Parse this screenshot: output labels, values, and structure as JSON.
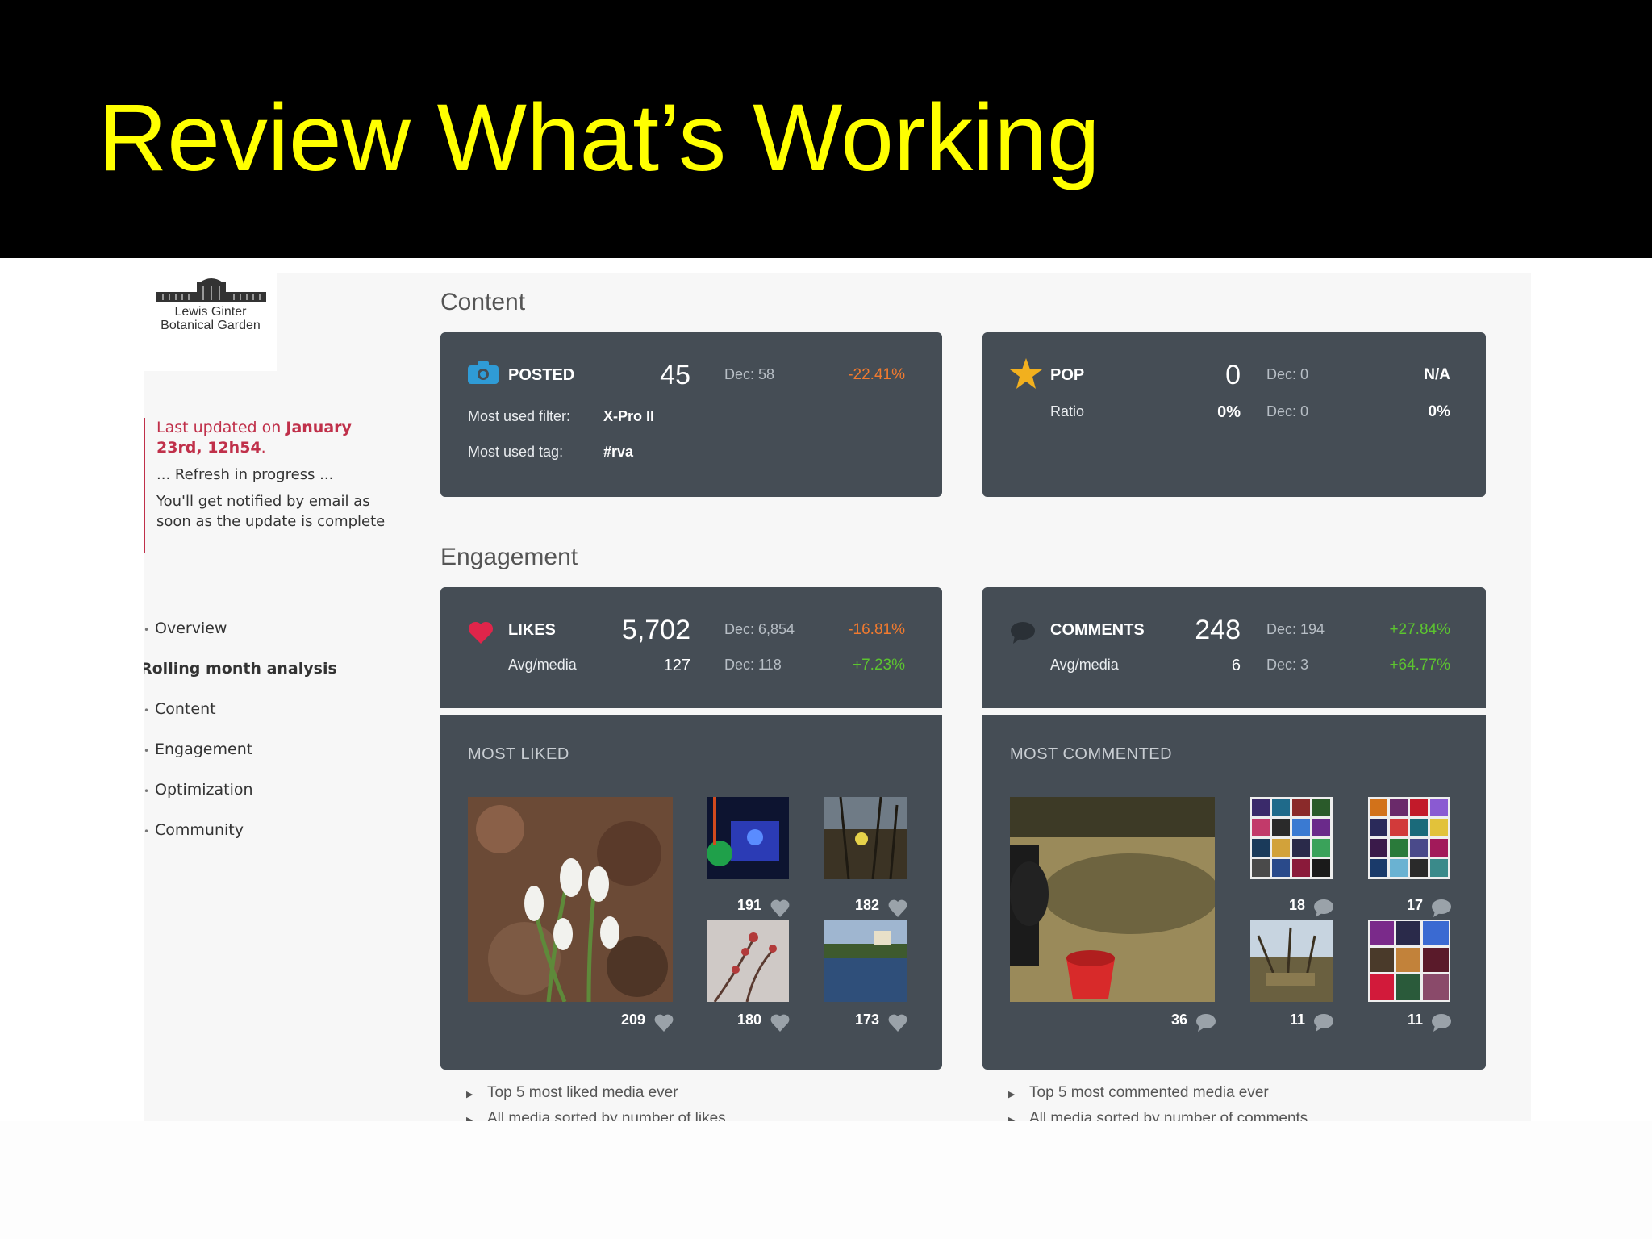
{
  "slide": {
    "title": "Review What’s Working"
  },
  "logo": {
    "line1": "Lewis Ginter",
    "line2": "Botanical Garden"
  },
  "update": {
    "prefix": "Last updated on ",
    "date_bold": "January 23rd, 12h54",
    "suffix": ".",
    "refresh": "... Refresh in progress ...",
    "notify": "You'll get notified by email as soon as the update is complete"
  },
  "nav": {
    "items": [
      {
        "label": "Overview"
      },
      {
        "label": "Rolling month analysis"
      },
      {
        "label": "Content"
      },
      {
        "label": "Engagement"
      },
      {
        "label": "Optimization"
      },
      {
        "label": "Community"
      }
    ]
  },
  "sections": {
    "content": "Content",
    "engagement": "Engagement"
  },
  "posted_card": {
    "label": "POSTED",
    "value": "45",
    "dec": "Dec: 58",
    "change": "-22.41%",
    "filter_label": "Most used filter:",
    "filter_value": "X-Pro II",
    "tag_label": "Most used tag:",
    "tag_value": "#rva"
  },
  "pop_card": {
    "label": "POP",
    "value": "0",
    "dec": "Dec: 0",
    "change": "N/A",
    "ratio_label": "Ratio",
    "ratio_value": "0%",
    "ratio_dec": "Dec: 0",
    "ratio_change": "0%"
  },
  "likes_card": {
    "label": "LIKES",
    "value": "5,702",
    "dec": "Dec: 6,854",
    "change": "-16.81%",
    "avg_label": "Avg/media",
    "avg_value": "127",
    "avg_dec": "Dec: 118",
    "avg_change": "+7.23%"
  },
  "comments_card": {
    "label": "COMMENTS",
    "value": "248",
    "dec": "Dec: 194",
    "change": "+27.84%",
    "avg_label": "Avg/media",
    "avg_value": "6",
    "avg_dec": "Dec: 3",
    "avg_change": "+64.77%"
  },
  "most_liked": {
    "title": "MOST LIKED",
    "counts": [
      "209",
      "191",
      "182",
      "180",
      "173"
    ]
  },
  "most_commented": {
    "title": "MOST COMMENTED",
    "counts": [
      "36",
      "18",
      "17",
      "11",
      "11"
    ]
  },
  "footnotes_liked": [
    "Top 5 most liked media ever",
    "All media sorted by number of likes"
  ],
  "footnotes_commented": [
    "Top 5 most commented media ever",
    "All media sorted by number of comments"
  ],
  "colors": {
    "title_yellow": "#ffff00",
    "card_bg": "#454d55",
    "negative": "#f07a2f",
    "positive": "#5cc52f",
    "accent_red": "#c0304a",
    "camera_blue": "#2f9bd6",
    "star_gold": "#f2b01e",
    "heart_red": "#e0254a"
  },
  "icons": [
    "camera-icon",
    "star-icon",
    "heart-icon",
    "comment-bubble-icon"
  ]
}
